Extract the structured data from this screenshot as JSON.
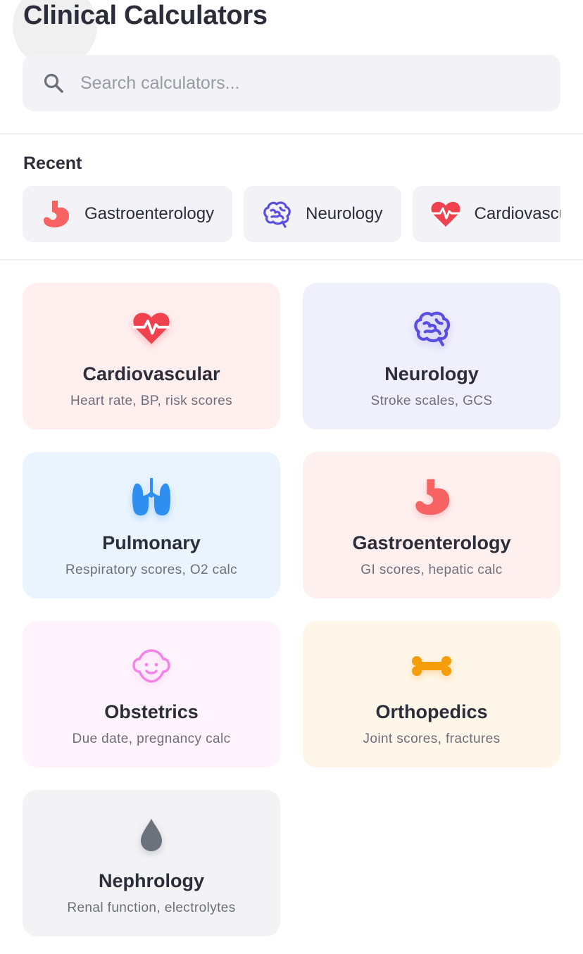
{
  "header": {
    "title": "Clinical Calculators"
  },
  "search": {
    "placeholder": "Search calculators..."
  },
  "recent": {
    "label": "Recent",
    "items": [
      {
        "label": "Gastroenterology",
        "icon": "stomach-icon"
      },
      {
        "label": "Neurology",
        "icon": "brain-icon"
      },
      {
        "label": "Cardiovascular",
        "icon": "heart-pulse-icon"
      }
    ]
  },
  "categories": [
    {
      "name": "Cardiovascular",
      "desc": "Heart rate, BP, risk scores",
      "icon": "heart-pulse-icon",
      "bg": "#ffefef",
      "color": "#f0424e"
    },
    {
      "name": "Neurology",
      "desc": "Stroke scales, GCS",
      "icon": "brain-icon",
      "bg": "#f0effc",
      "color": "#5a4ee0"
    },
    {
      "name": "Pulmonary",
      "desc": "Respiratory scores, O2 calc",
      "icon": "lungs-icon",
      "bg": "#eaf4fe",
      "color": "#2f8ff0"
    },
    {
      "name": "Gastroenterology",
      "desc": "GI scores, hepatic calc",
      "icon": "stomach-icon",
      "bg": "#fff0f0",
      "color": "#f76363"
    },
    {
      "name": "Obstetrics",
      "desc": "Due date, pregnancy calc",
      "icon": "baby-icon",
      "bg": "#fff4fd",
      "color": "#f383e6"
    },
    {
      "name": "Orthopedics",
      "desc": "Joint scores, fractures",
      "icon": "bone-icon",
      "bg": "#fff6ea",
      "color": "#f59d0b"
    },
    {
      "name": "Nephrology",
      "desc": "Renal function, electrolytes",
      "icon": "droplet-icon",
      "bg": "#f3f3f5",
      "color": "#6c717c"
    }
  ]
}
